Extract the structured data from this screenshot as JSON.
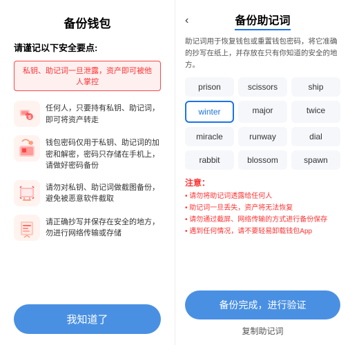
{
  "left": {
    "title": "备份钱包",
    "subtitle": "请谨记以下安全要点:",
    "warning": "私钥、助记词一旦泄露，资产即可被他人掌控",
    "items": [
      {
        "id": "transfer",
        "text": "任何人，只要持有私钥、助记词，即可将资产转走"
      },
      {
        "id": "encrypt",
        "text": "钱包密码仅用于私钥、助记词的加密和解密，密码只存储在手机上，请做好密码备份"
      },
      {
        "id": "screenshot",
        "text": "请勿对私钥、助记词做截图备份，避免被恶意软件截取"
      },
      {
        "id": "safe",
        "text": "请正确抄写并保存在安全的地方，勿进行网络传输或存储"
      }
    ],
    "button": "我知道了"
  },
  "right": {
    "title": "备份助记词",
    "back_icon": "‹",
    "description": "助记词用于恢复钱包或重置钱包密码，将它准确的抄写在纸上，并存放在只有你知道的安全的地方。",
    "words": [
      "prison",
      "scissors",
      "ship",
      "winter",
      "major",
      "twice",
      "miracle",
      "runway",
      "dial",
      "rabbit",
      "blossom",
      "spawn"
    ],
    "highlight_word": "winter",
    "notes_title": "注意：",
    "notes": [
      "请勿将助记词透露给任何人",
      "助记词一旦丢失，资产将无法恢复",
      "请勿通过截屏、网络传输的方式进行备份保存",
      "遇到任何情况，请不要轻易卸载钱包App"
    ],
    "verify_button": "备份完成，进行验证",
    "copy_button": "复制助记词"
  }
}
